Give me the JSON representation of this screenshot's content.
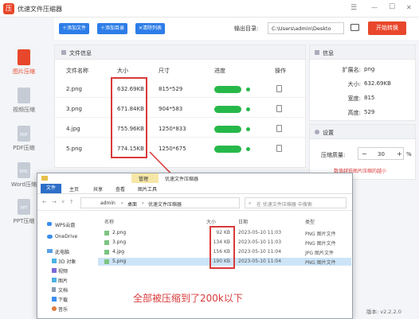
{
  "app": {
    "title": "优速文件压缩器",
    "logo": "压"
  },
  "window_controls": {
    "menu": "☰",
    "minimize": "—",
    "maximize": "☐",
    "close": "✕"
  },
  "toolbar": {
    "add_file": "添加文件",
    "add_dir": "添加目录",
    "clear": "清除列表",
    "output_label": "输出目录:",
    "output_path": "C:\\Users\\admin\\Deskto",
    "start": "开始转换"
  },
  "sidebar": [
    {
      "label": "图片压缩",
      "icon": "image-file-icon",
      "tag": ""
    },
    {
      "label": "视频压缩",
      "icon": "video-file-icon",
      "tag": ""
    },
    {
      "label": "PDF压缩",
      "icon": "pdf-file-icon",
      "tag": "PDF"
    },
    {
      "label": "Word压缩",
      "icon": "word-file-icon",
      "tag": "DOC"
    },
    {
      "label": "PPT压缩",
      "icon": "ppt-file-icon",
      "tag": "PPT"
    }
  ],
  "filelist": {
    "header": "文件信息",
    "columns": [
      "文件名称",
      "大小",
      "尺寸",
      "进度",
      "操作"
    ],
    "rows": [
      {
        "name": "2.png",
        "size": "632.69KB",
        "dim": "815*529",
        "progress": 1.0
      },
      {
        "name": "3.png",
        "size": "671.84KB",
        "dim": "904*583",
        "progress": 1.0
      },
      {
        "name": "4.jpg",
        "size": "755.96KB",
        "dim": "1250*833",
        "progress": 1.0
      },
      {
        "name": "5.png",
        "size": "774.15KB",
        "dim": "1250*675",
        "progress": 1.0
      }
    ]
  },
  "info": {
    "header": "信息",
    "fields": [
      {
        "k": "扩展名:",
        "v": "png"
      },
      {
        "k": "大小:",
        "v": "632.69KB"
      },
      {
        "k": "宽度:",
        "v": "815"
      },
      {
        "k": "高度:",
        "v": "529"
      }
    ]
  },
  "settings": {
    "header": "设置",
    "quality_label": "压缩质量:",
    "minus": "−",
    "quality": "30",
    "plus": "+",
    "unit": "%",
    "hint": "数值越低图片压缩的越小"
  },
  "version": "版本: v2.2.2.0",
  "explorer": {
    "manage_tab": "管理",
    "title": "优速文件压缩器",
    "ribbon": [
      "文件",
      "主页",
      "共享",
      "查看",
      "图片工具"
    ],
    "breadcrumb": [
      "admin",
      "桌面",
      "优速文件压缩器"
    ],
    "search_placeholder": "在 优速文件压缩器 中搜索",
    "nav": [
      {
        "label": "WPS云盘",
        "icon": "cloud-icon"
      },
      {
        "label": "OneDrive",
        "icon": "onedrive-icon"
      },
      {
        "label": "此电脑",
        "icon": "computer-icon"
      },
      {
        "label": "3D 对象",
        "icon": "cube-icon"
      },
      {
        "label": "视频",
        "icon": "video-icon"
      },
      {
        "label": "图片",
        "icon": "picture-icon"
      },
      {
        "label": "文档",
        "icon": "document-icon"
      },
      {
        "label": "下载",
        "icon": "download-icon"
      },
      {
        "label": "音乐",
        "icon": "music-icon"
      }
    ],
    "columns": [
      "名称",
      "大小",
      "日期",
      "类型"
    ],
    "files": [
      {
        "name": "2.png",
        "size": "92 KB",
        "date": "2023-05-10 11:03",
        "type": "PNG 图片文件"
      },
      {
        "name": "3.png",
        "size": "134 KB",
        "date": "2023-05-10 11:03",
        "type": "PNG 图片文件"
      },
      {
        "name": "4.jpg",
        "size": "156 KB",
        "date": "2023-05-10 11:04",
        "type": "JPG 图片文件"
      },
      {
        "name": "5.png",
        "size": "190 KB",
        "date": "2023-05-10 11:04",
        "type": "PNG 图片文件"
      }
    ]
  },
  "annotation": "全部被压缩到了200k以下",
  "colors": {
    "accent": "#2d7de8",
    "start": "#e8472b",
    "progress": "#27b84a",
    "annotation": "#d93a3a"
  }
}
